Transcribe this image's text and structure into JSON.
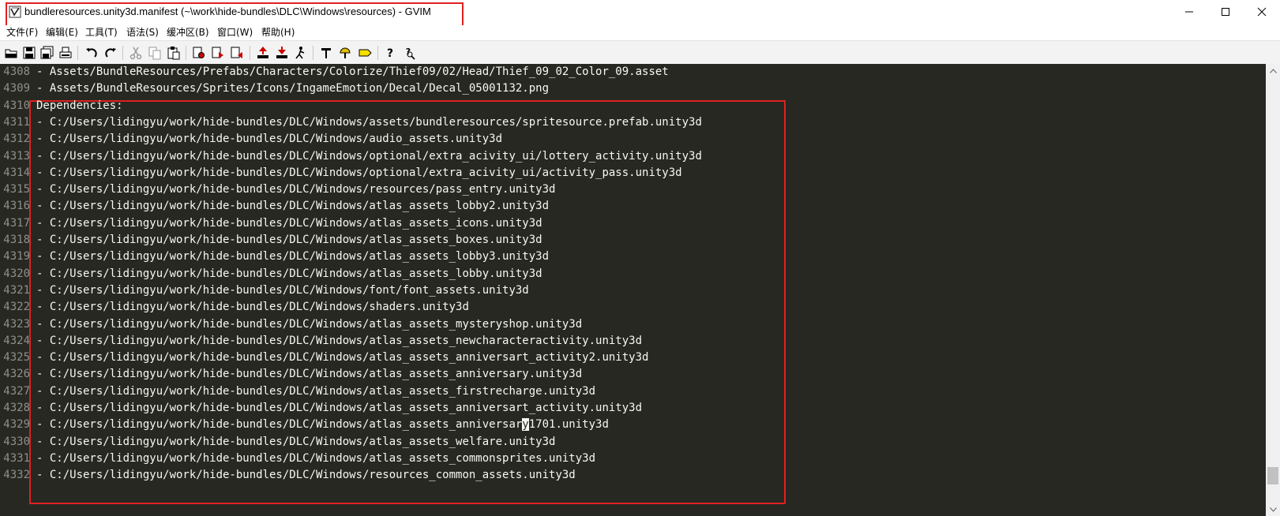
{
  "window": {
    "title": "bundleresources.unity3d.manifest (~\\work\\hide-bundles\\DLC\\Windows\\resources) - GVIM",
    "icon": "gvim-icon"
  },
  "menu": [
    {
      "label": "文件(F)"
    },
    {
      "label": "编辑(E)"
    },
    {
      "label": "工具(T)"
    },
    {
      "label": "语法(S)"
    },
    {
      "label": "缓冲区(B)"
    },
    {
      "label": "窗口(W)"
    },
    {
      "label": "帮助(H)"
    }
  ],
  "toolbar_icons": [
    "open-icon",
    "save-icon",
    "save-all-icon",
    "print-icon",
    "undo-icon",
    "redo-icon",
    "cut-icon",
    "copy-icon",
    "paste-icon",
    "find-replace-icon",
    "find-next-icon",
    "find-prev-icon",
    "load-session-icon",
    "save-session-icon",
    "run-script-icon",
    "make-icon",
    "shell-icon",
    "tags-icon",
    "help-icon",
    "find-help-icon"
  ],
  "editor": {
    "lines": [
      {
        "num": "4308",
        "text": "- Assets/BundleResources/Prefabs/Characters/Colorize/Thief09/02/Head/Thief_09_02_Color_09.asset"
      },
      {
        "num": "4309",
        "text": "- Assets/BundleResources/Sprites/Icons/IngameEmotion/Decal/Decal_05001132.png"
      },
      {
        "num": "4310",
        "text": "Dependencies:"
      },
      {
        "num": "4311",
        "text": "- C:/Users/lidingyu/work/hide-bundles/DLC/Windows/assets/bundleresources/spritesource.prefab.unity3d"
      },
      {
        "num": "4312",
        "text": "- C:/Users/lidingyu/work/hide-bundles/DLC/Windows/audio_assets.unity3d"
      },
      {
        "num": "4313",
        "text": "- C:/Users/lidingyu/work/hide-bundles/DLC/Windows/optional/extra_acivity_ui/lottery_activity.unity3d"
      },
      {
        "num": "4314",
        "text": "- C:/Users/lidingyu/work/hide-bundles/DLC/Windows/optional/extra_acivity_ui/activity_pass.unity3d"
      },
      {
        "num": "4315",
        "text": "- C:/Users/lidingyu/work/hide-bundles/DLC/Windows/resources/pass_entry.unity3d"
      },
      {
        "num": "4316",
        "text": "- C:/Users/lidingyu/work/hide-bundles/DLC/Windows/atlas_assets_lobby2.unity3d"
      },
      {
        "num": "4317",
        "text": "- C:/Users/lidingyu/work/hide-bundles/DLC/Windows/atlas_assets_icons.unity3d"
      },
      {
        "num": "4318",
        "text": "- C:/Users/lidingyu/work/hide-bundles/DLC/Windows/atlas_assets_boxes.unity3d"
      },
      {
        "num": "4319",
        "text": "- C:/Users/lidingyu/work/hide-bundles/DLC/Windows/atlas_assets_lobby3.unity3d"
      },
      {
        "num": "4320",
        "text": "- C:/Users/lidingyu/work/hide-bundles/DLC/Windows/atlas_assets_lobby.unity3d"
      },
      {
        "num": "4321",
        "text": "- C:/Users/lidingyu/work/hide-bundles/DLC/Windows/font/font_assets.unity3d"
      },
      {
        "num": "4322",
        "text": "- C:/Users/lidingyu/work/hide-bundles/DLC/Windows/shaders.unity3d"
      },
      {
        "num": "4323",
        "text": "- C:/Users/lidingyu/work/hide-bundles/DLC/Windows/atlas_assets_mysteryshop.unity3d"
      },
      {
        "num": "4324",
        "text": "- C:/Users/lidingyu/work/hide-bundles/DLC/Windows/atlas_assets_newcharacteractivity.unity3d"
      },
      {
        "num": "4325",
        "text": "- C:/Users/lidingyu/work/hide-bundles/DLC/Windows/atlas_assets_anniversart_activity2.unity3d"
      },
      {
        "num": "4326",
        "text": "- C:/Users/lidingyu/work/hide-bundles/DLC/Windows/atlas_assets_anniversary.unity3d"
      },
      {
        "num": "4327",
        "text": "- C:/Users/lidingyu/work/hide-bundles/DLC/Windows/atlas_assets_firstrecharge.unity3d"
      },
      {
        "num": "4328",
        "text": "- C:/Users/lidingyu/work/hide-bundles/DLC/Windows/atlas_assets_anniversart_activity.unity3d"
      },
      {
        "num": "4329",
        "text_before": "- C:/Users/lidingyu/work/hide-bundles/DLC/Windows/atlas_assets_anniversar",
        "cursor_char": "y",
        "text_after": "1701.unity3d"
      },
      {
        "num": "4330",
        "text": "- C:/Users/lidingyu/work/hide-bundles/DLC/Windows/atlas_assets_welfare.unity3d"
      },
      {
        "num": "4331",
        "text": "- C:/Users/lidingyu/work/hide-bundles/DLC/Windows/atlas_assets_commonsprites.unity3d"
      },
      {
        "num": "4332",
        "text": "- C:/Users/lidingyu/work/hide-bundles/DLC/Windows/resources_common_assets.unity3d"
      }
    ]
  },
  "colors": {
    "editor_bg": "#272822",
    "editor_fg": "#f8f8f2",
    "line_number": "#90908a",
    "highlight_box": "#e02020"
  }
}
